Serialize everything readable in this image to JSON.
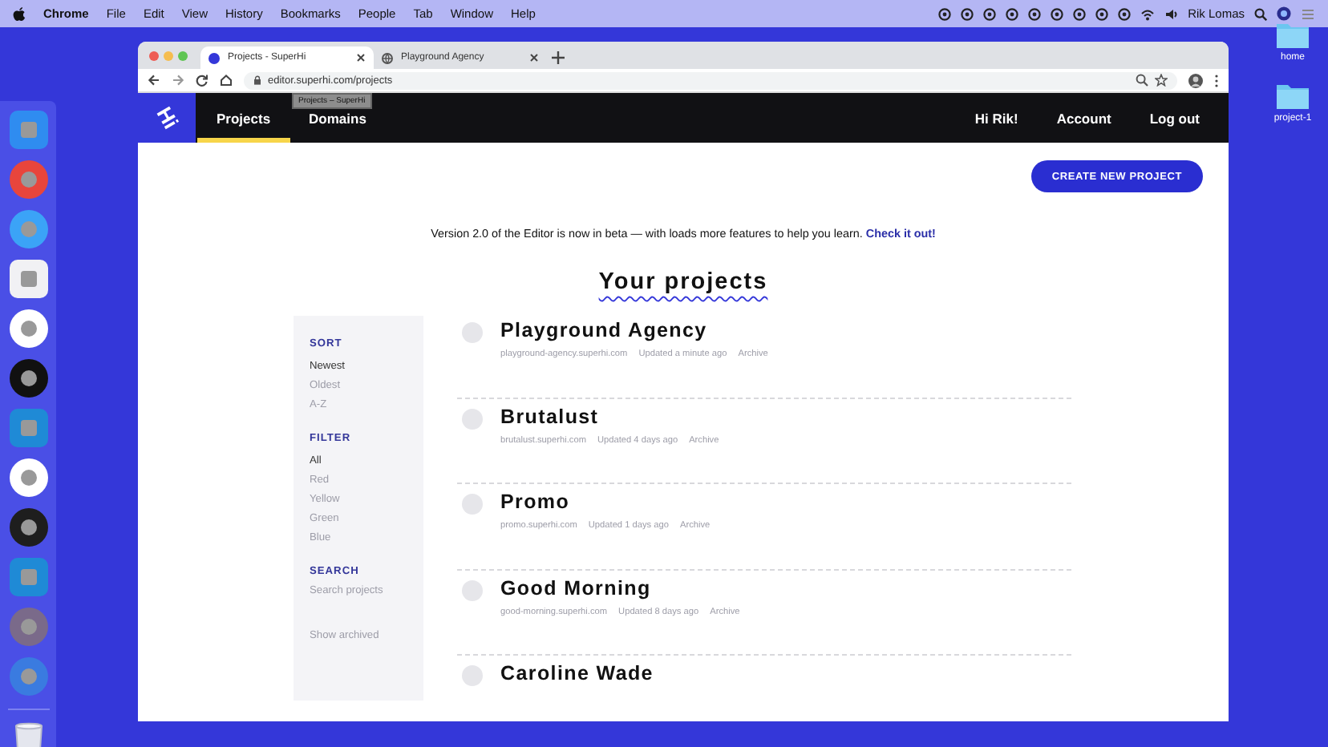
{
  "menu_bar": {
    "app": "Chrome",
    "items": [
      "File",
      "Edit",
      "View",
      "History",
      "Bookmarks",
      "People",
      "Tab",
      "Window",
      "Help"
    ],
    "user": "Rik Lomas"
  },
  "desktop": {
    "folders": [
      "home",
      "project-1"
    ]
  },
  "browser": {
    "tabs": [
      {
        "title": "Projects - SuperHi",
        "selected": true
      },
      {
        "title": "Playground Agency",
        "selected": false
      }
    ],
    "url": "editor.superhi.com/projects",
    "tooltip": "Projects – SuperHi"
  },
  "site": {
    "logo": "Hi",
    "nav": [
      {
        "label": "Projects",
        "selected": true
      },
      {
        "label": "Domains",
        "selected": false
      }
    ],
    "greeting": "Hi Rik!",
    "account_links": [
      "Account",
      "Log out"
    ],
    "create_button": "CREATE NEW PROJECT",
    "banner": {
      "text": "Version 2.0 of the Editor is now in beta — with loads more features to help you learn.",
      "link": "Check it out!"
    },
    "heading": "Your projects",
    "sidebar": {
      "sections": [
        {
          "title": "SORT",
          "options": [
            {
              "label": "Newest",
              "selected": true
            },
            {
              "label": "Oldest",
              "selected": false
            },
            {
              "label": "A-Z",
              "selected": false
            }
          ]
        },
        {
          "title": "FILTER",
          "options": [
            {
              "label": "All",
              "selected": true
            },
            {
              "label": "Red",
              "selected": false
            },
            {
              "label": "Yellow",
              "selected": false
            },
            {
              "label": "Green",
              "selected": false
            },
            {
              "label": "Blue",
              "selected": false
            }
          ]
        }
      ],
      "search": {
        "title": "SEARCH",
        "placeholder": "Search projects"
      },
      "show_archived": "Show archived"
    },
    "projects": [
      {
        "name": "Playground Agency",
        "domain": "playground-agency.superhi.com",
        "updated": "Updated a minute ago",
        "action": "Archive"
      },
      {
        "name": "Brutalust",
        "domain": "brutalust.superhi.com",
        "updated": "Updated 4 days ago",
        "action": "Archive"
      },
      {
        "name": "Promo",
        "domain": "promo.superhi.com",
        "updated": "Updated 1 days ago",
        "action": "Archive"
      },
      {
        "name": "Good Morning",
        "domain": "good-morning.superhi.com",
        "updated": "Updated 8 days ago",
        "action": "Archive"
      },
      {
        "name": "Caroline Wade"
      }
    ]
  }
}
